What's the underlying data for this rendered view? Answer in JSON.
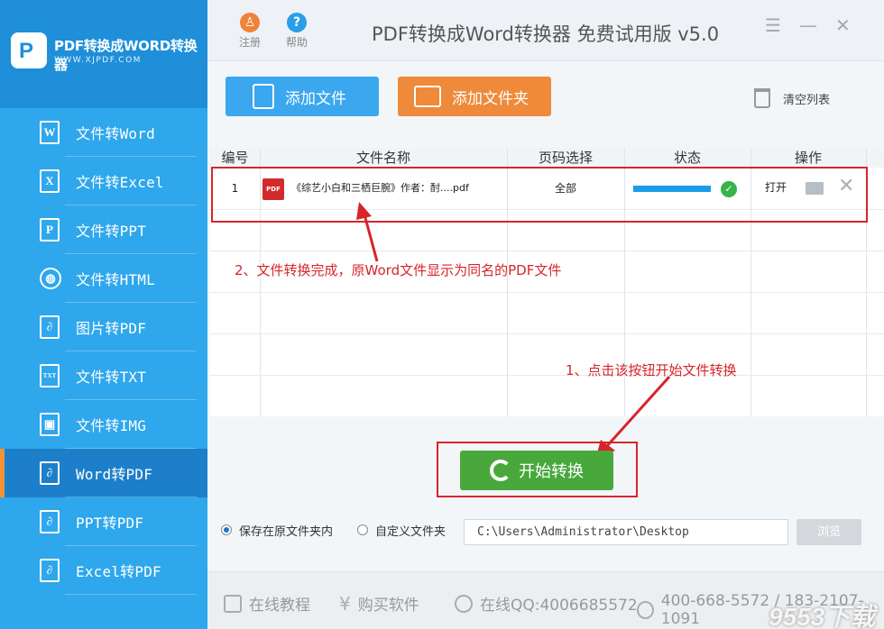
{
  "brand": {
    "logo_letter": "P",
    "name": "PDF转换成WORD转换器",
    "url": "WWW.XJPDF.COM"
  },
  "sidebar": {
    "items": [
      {
        "label": "文件转Word",
        "icon": "W"
      },
      {
        "label": "文件转Excel",
        "icon": "X"
      },
      {
        "label": "文件转PPT",
        "icon": "P"
      },
      {
        "label": "文件转HTML",
        "icon": "◍"
      },
      {
        "label": "图片转PDF",
        "icon": "∂"
      },
      {
        "label": "文件转TXT",
        "icon": "TXT"
      },
      {
        "label": "文件转IMG",
        "icon": "▣"
      },
      {
        "label": "Word转PDF",
        "icon": "∂",
        "active": true
      },
      {
        "label": "PPT转PDF",
        "icon": "∂"
      },
      {
        "label": "Excel转PDF",
        "icon": "∂"
      }
    ]
  },
  "titlebar": {
    "register": {
      "label": "注册",
      "glyph": "♙",
      "color": "#f0823a"
    },
    "help": {
      "label": "帮助",
      "glyph": "?",
      "color": "#2b9ee8"
    },
    "title": "PDF转换成Word转换器 免费试用版 v5.0",
    "menu_glyph": "☰",
    "minimize_glyph": "—",
    "close_glyph": "✕"
  },
  "toolbar": {
    "add_file": "添加文件",
    "add_folder": "添加文件夹",
    "clear_list": "清空列表",
    "add_file_color": "#3aa7ef",
    "add_folder_color": "#ee8a3a"
  },
  "table": {
    "headers": [
      "编号",
      "文件名称",
      "页码选择",
      "状态",
      "操作"
    ],
    "rows": [
      {
        "index": "1",
        "pdf_badge": "PDF",
        "filename": "《综艺小白和三栖巨腕》作者：酎....pdf",
        "pages": "全部",
        "progress": 1.0,
        "action": "打开"
      }
    ]
  },
  "annotations": {
    "note2": "2、文件转换完成，原Word文件显示为同名的PDF文件",
    "note1": "1、点击该按钮开始文件转换"
  },
  "start_button": "开始转换",
  "output": {
    "option_original": "保存在原文件夹内",
    "option_custom": "自定义文件夹",
    "path": "C:\\Users\\Administrator\\Desktop",
    "browse": "浏览"
  },
  "footer": {
    "tutorial": "在线教程",
    "buy": "购买软件",
    "qq": "在线QQ:4006685572",
    "phone": "400-668-5572 / 183-2107-1091"
  },
  "watermark": "9553下载"
}
